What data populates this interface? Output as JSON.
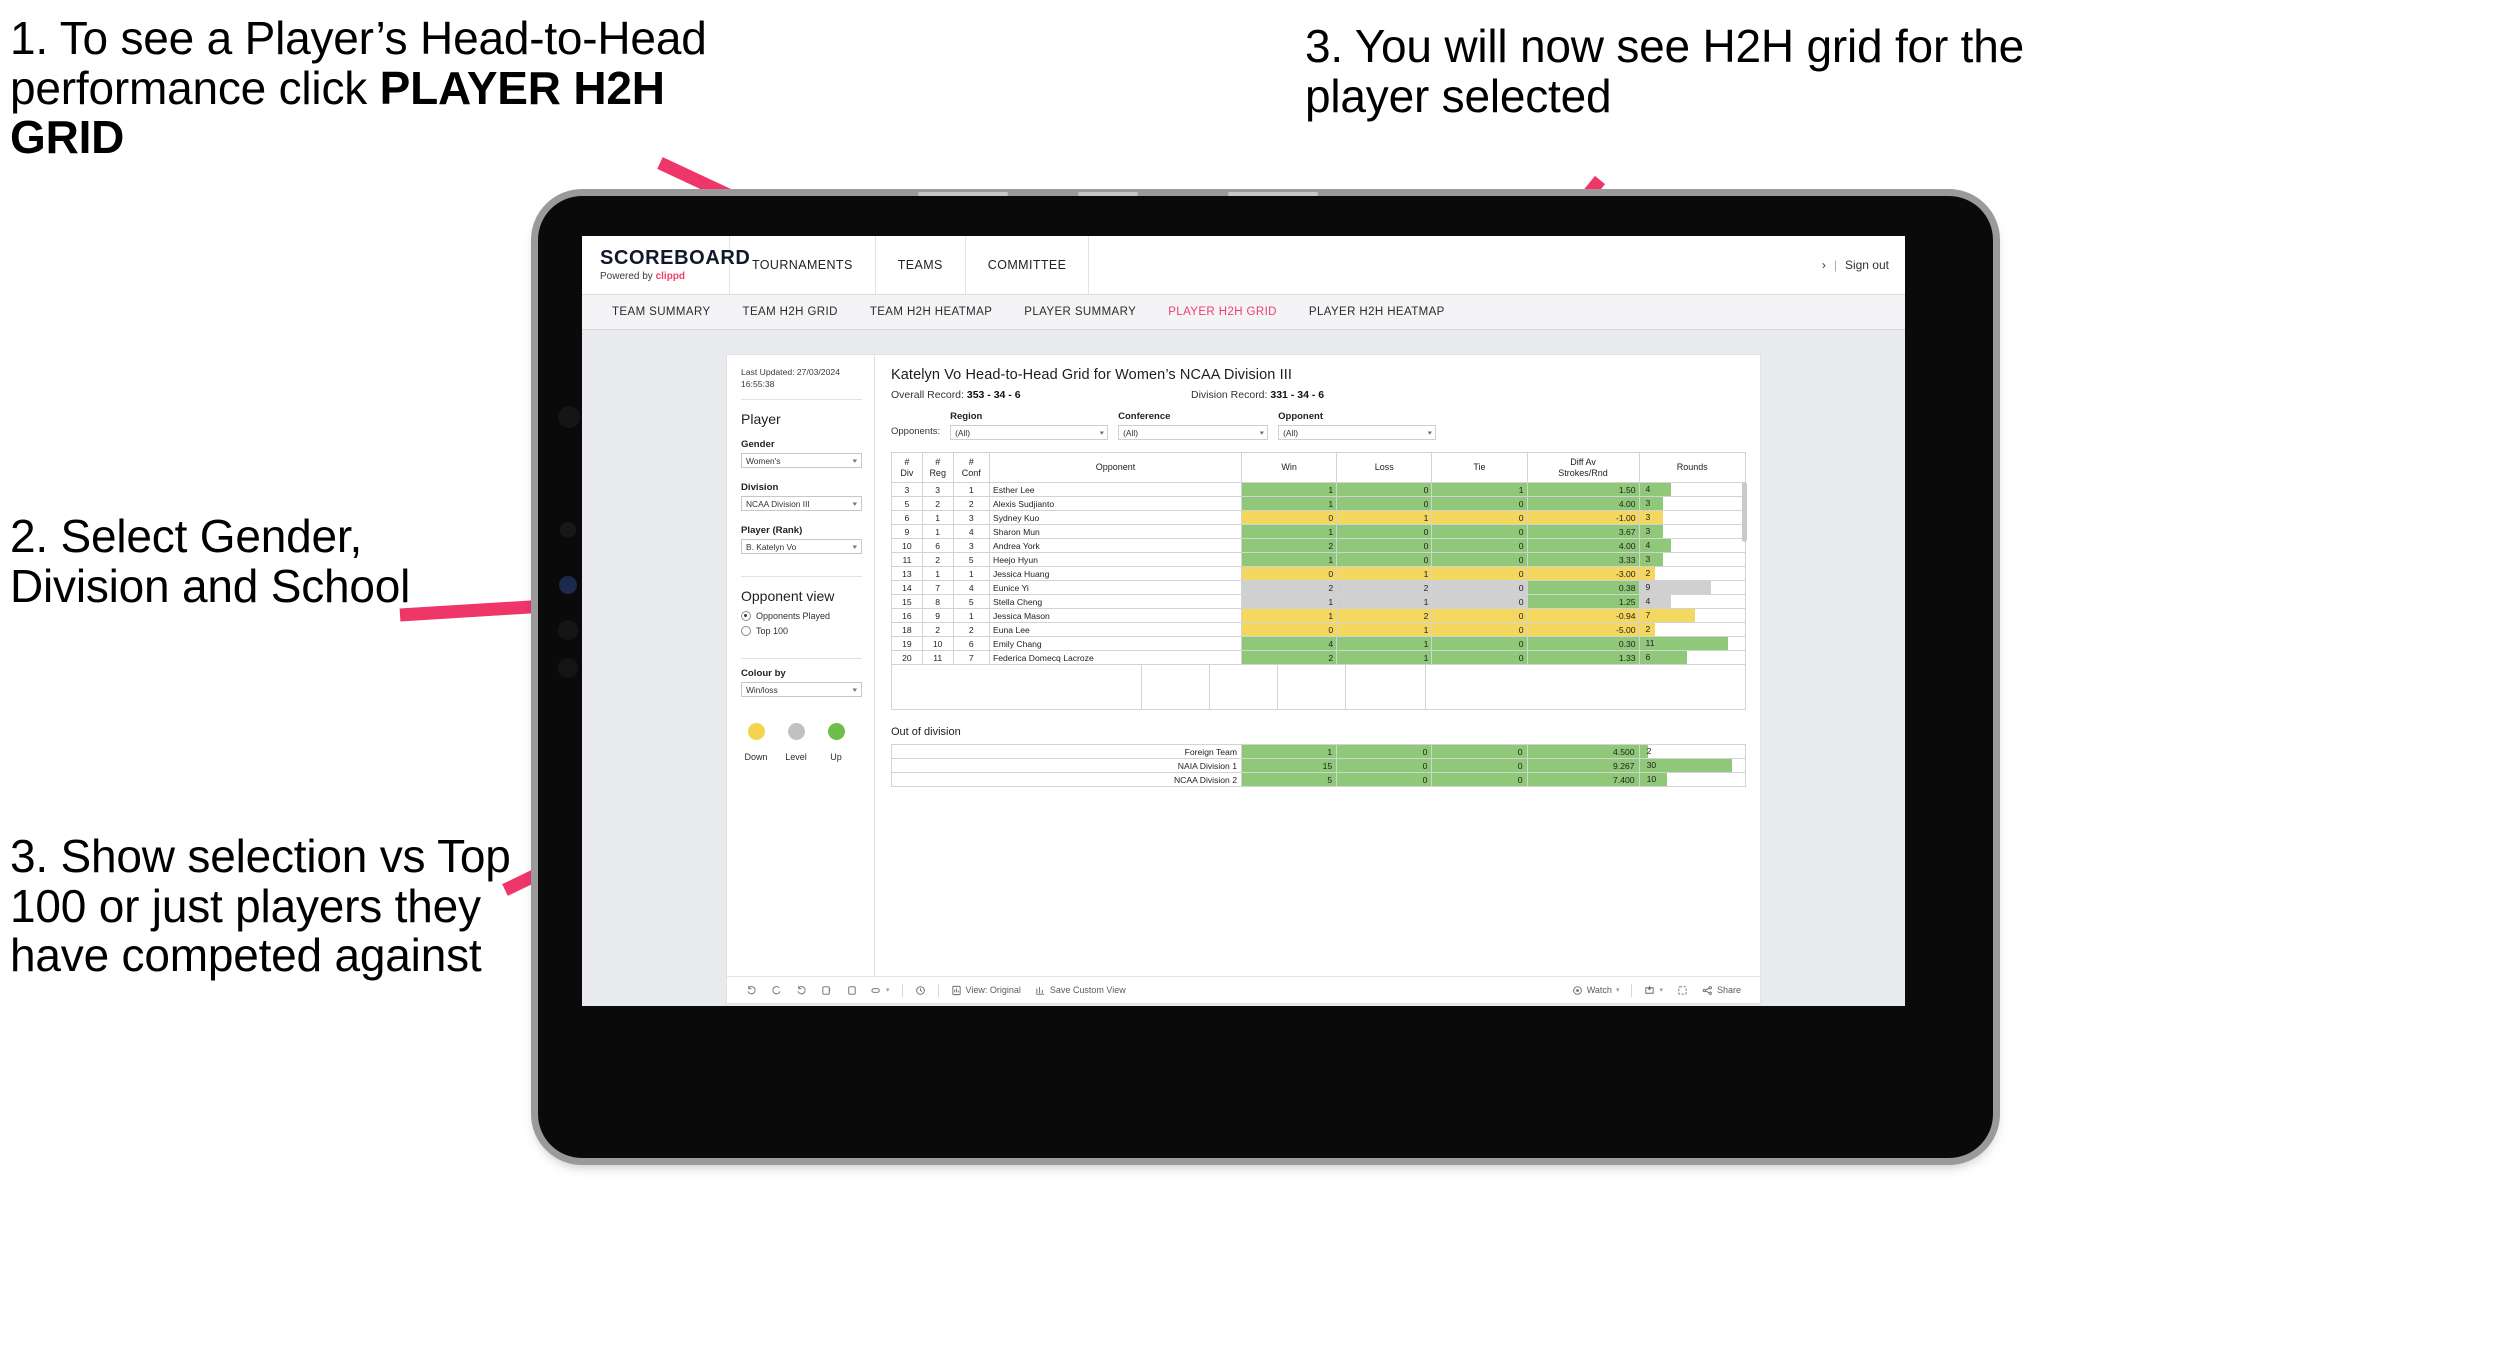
{
  "annotations": [
    {
      "id": "a1",
      "text_plain": "1. To see a Player’s Head-to-Head performance click ",
      "text_bold": "PLAYER H2H GRID"
    },
    {
      "id": "a2",
      "text": "2. Select Gender, Division and School"
    },
    {
      "id": "a3",
      "text": "3. Show selection vs Top 100 or just players they have competed against"
    },
    {
      "id": "a4",
      "text": "3. You will now see H2H grid for the player selected"
    }
  ],
  "app": {
    "brand": {
      "title": "SCOREBOARD",
      "sub_prefix": "Powered by ",
      "sub_brand": "clippd"
    },
    "header_links": [
      "TOURNAMENTS",
      "TEAMS",
      "COMMITTEE"
    ],
    "header_right": {
      "user": "›",
      "separator": "|",
      "sign_out": "Sign out"
    },
    "tabs": [
      {
        "label": "TEAM SUMMARY",
        "active": false
      },
      {
        "label": "TEAM H2H GRID",
        "active": false
      },
      {
        "label": "TEAM H2H HEATMAP",
        "active": false
      },
      {
        "label": "PLAYER SUMMARY",
        "active": false
      },
      {
        "label": "PLAYER H2H GRID",
        "active": true
      },
      {
        "label": "PLAYER H2H HEATMAP",
        "active": false
      }
    ],
    "accent_color": "#ef3e6d"
  },
  "sidebar": {
    "last_updated": "Last Updated: 27/03/2024 16:55:38",
    "section_player": "Player",
    "fields": [
      {
        "label": "Gender",
        "value": "Women's"
      },
      {
        "label": "Division",
        "value": "NCAA Division III"
      },
      {
        "label": "Player (Rank)",
        "value": "B. Katelyn Vo"
      }
    ],
    "opponent_view": {
      "title": "Opponent view",
      "options": [
        {
          "label": "Opponents Played",
          "selected": true
        },
        {
          "label": "Top 100",
          "selected": false
        }
      ]
    },
    "colour_by": {
      "label": "Colour by",
      "value": "Win/loss"
    },
    "legend": [
      {
        "label": "Down",
        "color": "#f2d44e"
      },
      {
        "label": "Level",
        "color": "#bfc1c3"
      },
      {
        "label": "Up",
        "color": "#6dbe4b"
      }
    ]
  },
  "main": {
    "title": "Katelyn Vo Head-to-Head Grid for Women’s NCAA Division III",
    "overall_record_label": "Overall Record: ",
    "overall_record_value": "353 -  34 - 6",
    "division_record_label": "Division Record: ",
    "division_record_value": "331 -  34 - 6",
    "opponents_label": "Opponents:",
    "filters": [
      {
        "label": "Region",
        "value": "(All)"
      },
      {
        "label": "Conference",
        "value": "(All)"
      },
      {
        "label": "Opponent",
        "value": "(All)"
      }
    ],
    "columns": [
      "# Div",
      "# Reg",
      "# Conf",
      "Opponent",
      "Win",
      "Loss",
      "Tie",
      "Diff Av Strokes/Rnd",
      "Rounds"
    ],
    "rows": [
      {
        "div": "3",
        "reg": "3",
        "conf": "1",
        "opponent": "Esther Lee",
        "win": "1",
        "loss": "0",
        "tie": "1",
        "diff": "1.50",
        "rounds": "4",
        "color": "green",
        "bar_pct": 30
      },
      {
        "div": "5",
        "reg": "2",
        "conf": "2",
        "opponent": "Alexis Sudjianto",
        "win": "1",
        "loss": "0",
        "tie": "0",
        "diff": "4.00",
        "rounds": "3",
        "color": "green",
        "bar_pct": 22
      },
      {
        "div": "6",
        "reg": "1",
        "conf": "3",
        "opponent": "Sydney Kuo",
        "win": "0",
        "loss": "1",
        "tie": "0",
        "diff": "-1.00",
        "rounds": "3",
        "color": "yellow",
        "bar_pct": 22
      },
      {
        "div": "9",
        "reg": "1",
        "conf": "4",
        "opponent": "Sharon Mun",
        "win": "1",
        "loss": "0",
        "tie": "0",
        "diff": "3.67",
        "rounds": "3",
        "color": "green",
        "bar_pct": 22
      },
      {
        "div": "10",
        "reg": "6",
        "conf": "3",
        "opponent": "Andrea York",
        "win": "2",
        "loss": "0",
        "tie": "0",
        "diff": "4.00",
        "rounds": "4",
        "color": "green",
        "bar_pct": 30
      },
      {
        "div": "11",
        "reg": "2",
        "conf": "5",
        "opponent": "Heejo Hyun",
        "win": "1",
        "loss": "0",
        "tie": "0",
        "diff": "3.33",
        "rounds": "3",
        "color": "green",
        "bar_pct": 22
      },
      {
        "div": "13",
        "reg": "1",
        "conf": "1",
        "opponent": "Jessica Huang",
        "win": "0",
        "loss": "1",
        "tie": "0",
        "diff": "-3.00",
        "rounds": "2",
        "color": "yellow",
        "bar_pct": 15
      },
      {
        "div": "14",
        "reg": "7",
        "conf": "4",
        "opponent": "Eunice Yi",
        "win": "2",
        "loss": "2",
        "tie": "0",
        "diff": "0.38",
        "rounds": "9",
        "color": "grey",
        "bar_pct": 68
      },
      {
        "div": "15",
        "reg": "8",
        "conf": "5",
        "opponent": "Stella Cheng",
        "win": "1",
        "loss": "1",
        "tie": "0",
        "diff": "1.25",
        "rounds": "4",
        "color": "grey",
        "bar_pct": 30
      },
      {
        "div": "16",
        "reg": "9",
        "conf": "1",
        "opponent": "Jessica Mason",
        "win": "1",
        "loss": "2",
        "tie": "0",
        "diff": "-0.94",
        "rounds": "7",
        "color": "yellow",
        "bar_pct": 53
      },
      {
        "div": "18",
        "reg": "2",
        "conf": "2",
        "opponent": "Euna Lee",
        "win": "0",
        "loss": "1",
        "tie": "0",
        "diff": "-5.00",
        "rounds": "2",
        "color": "yellow",
        "bar_pct": 15
      },
      {
        "div": "19",
        "reg": "10",
        "conf": "6",
        "opponent": "Emily Chang",
        "win": "4",
        "loss": "1",
        "tie": "0",
        "diff": "0.30",
        "rounds": "11",
        "color": "green",
        "bar_pct": 84
      },
      {
        "div": "20",
        "reg": "11",
        "conf": "7",
        "opponent": "Federica Domecq Lacroze",
        "win": "2",
        "loss": "1",
        "tie": "0",
        "diff": "1.33",
        "rounds": "6",
        "color": "green",
        "bar_pct": 45
      }
    ],
    "out_of_division": {
      "title": "Out of division",
      "rows": [
        {
          "name": "Foreign Team",
          "win": "1",
          "loss": "0",
          "tie": "0",
          "diff": "4.500",
          "rounds": "2",
          "color": "green",
          "bar_pct": 8
        },
        {
          "name": "NAIA Division 1",
          "win": "15",
          "loss": "0",
          "tie": "0",
          "diff": "9.267",
          "rounds": "30",
          "color": "green",
          "bar_pct": 88
        },
        {
          "name": "NCAA Division 2",
          "win": "5",
          "loss": "0",
          "tie": "0",
          "diff": "7.400",
          "rounds": "10",
          "color": "green",
          "bar_pct": 26
        }
      ]
    },
    "toolbar": {
      "view_original": "View: Original",
      "save_custom_view": "Save Custom View",
      "watch": "Watch",
      "share": "Share"
    }
  }
}
